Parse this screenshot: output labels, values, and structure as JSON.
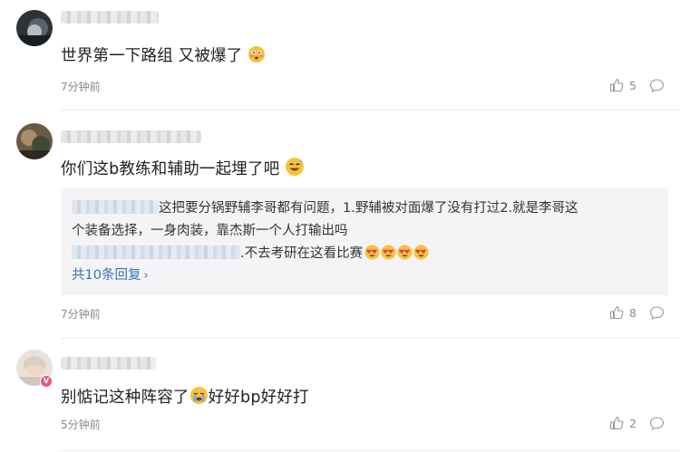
{
  "comments": [
    {
      "content": "世界第一下路组 又被爆了",
      "time": "7分钟前",
      "likes": "5",
      "emoji": "flushed-emoji"
    },
    {
      "content": "你们这b教练和辅助一起埋了吧",
      "time": "7分钟前",
      "likes": "8",
      "emoji": "sweat-smile-emoji",
      "replies": {
        "line1": "这把要分锅野辅李哥都有问题，1.野辅被对面爆了没有打过2.就是李哥这",
        "line2": "个装备选择，一身肉装，靠杰斯一个人打输出吗",
        "line3": ".不去考研在这看比赛",
        "line3_emoji": "heart-eyes-emoji",
        "more": "共10条回复"
      }
    },
    {
      "content_a": "别惦记这种阵容了",
      "content_b": "好好bp好好打",
      "time": "5分钟前",
      "likes": "2",
      "emoji": "crying-emoji"
    }
  ],
  "colors": {
    "link": "#3a6fb6",
    "meta": "#8a8a8a",
    "reply_bg": "#f4f4f6",
    "vip_badge": "#e8587a"
  },
  "icons": [
    "thumbs-up-icon",
    "comment-icon",
    "vip-badge-icon"
  ]
}
